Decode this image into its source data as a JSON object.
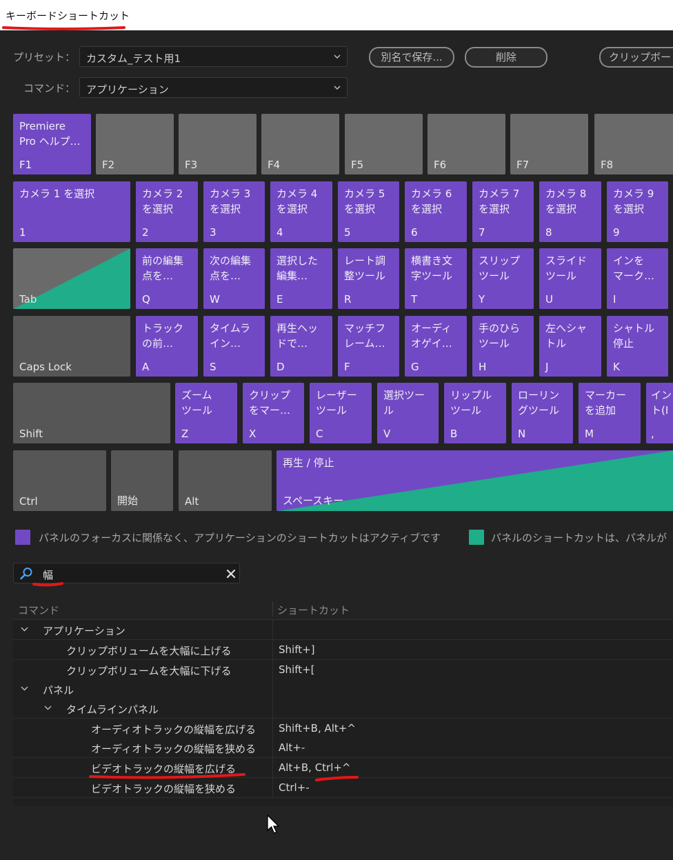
{
  "window": {
    "title": "キーボードショートカット"
  },
  "form": {
    "preset_label": "プリセット：",
    "preset_value": "カスタム_テスト用1",
    "command_label": "コマンド：",
    "command_value": "アプリケーション",
    "buttons": {
      "save_as": "別名で保存...",
      "delete": "削除",
      "clipboard": "クリップボー"
    }
  },
  "keyboard": {
    "fn_row": [
      {
        "cap": "F1",
        "cmd": "Premiere\nPro ヘルプ…"
      },
      {
        "cap": "F2",
        "cmd": ""
      },
      {
        "cap": "F3",
        "cmd": ""
      },
      {
        "cap": "F4",
        "cmd": ""
      },
      {
        "cap": "F5",
        "cmd": ""
      },
      {
        "cap": "F6",
        "cmd": ""
      },
      {
        "cap": "F7",
        "cmd": ""
      },
      {
        "cap": "F8",
        "cmd": ""
      }
    ],
    "num_row": [
      {
        "cap": "1",
        "cmd": "カメラ 1 を選択"
      },
      {
        "cap": "2",
        "cmd": "カメラ 2\nを選択"
      },
      {
        "cap": "3",
        "cmd": "カメラ 3\nを選択"
      },
      {
        "cap": "4",
        "cmd": "カメラ 4\nを選択"
      },
      {
        "cap": "5",
        "cmd": "カメラ 5\nを選択"
      },
      {
        "cap": "6",
        "cmd": "カメラ 6\nを選択"
      },
      {
        "cap": "7",
        "cmd": "カメラ 7\nを選択"
      },
      {
        "cap": "8",
        "cmd": "カメラ 8\nを選択"
      },
      {
        "cap": "9",
        "cmd": "カメラ 9\nを選択"
      }
    ],
    "q_row": [
      {
        "cap": "Tab",
        "cmd": ""
      },
      {
        "cap": "Q",
        "cmd": "前の編集\n点を…"
      },
      {
        "cap": "W",
        "cmd": "次の編集\n点を…"
      },
      {
        "cap": "E",
        "cmd": "選択した\n編集…"
      },
      {
        "cap": "R",
        "cmd": "レート調\n整ツール"
      },
      {
        "cap": "T",
        "cmd": "横書き文\n字ツール"
      },
      {
        "cap": "Y",
        "cmd": "スリップ\nツール"
      },
      {
        "cap": "U",
        "cmd": "スライド\nツール"
      },
      {
        "cap": "I",
        "cmd": "インを\nマーク…"
      }
    ],
    "a_row": [
      {
        "cap": "Caps Lock",
        "cmd": ""
      },
      {
        "cap": "A",
        "cmd": "トラック\nの前…"
      },
      {
        "cap": "S",
        "cmd": "タイムラ\nイン…"
      },
      {
        "cap": "D",
        "cmd": "再生ヘッ\nドで…"
      },
      {
        "cap": "F",
        "cmd": "マッチフ\nレーム…"
      },
      {
        "cap": "G",
        "cmd": "オーディ\nオゲイ…"
      },
      {
        "cap": "H",
        "cmd": "手のひら\nツール"
      },
      {
        "cap": "J",
        "cmd": "左へシャ\nトル"
      },
      {
        "cap": "K",
        "cmd": "シャトル\n停止"
      }
    ],
    "z_row": [
      {
        "cap": "Shift",
        "cmd": ""
      },
      {
        "cap": "Z",
        "cmd": "ズーム\nツール"
      },
      {
        "cap": "X",
        "cmd": "クリップ\nをマー…"
      },
      {
        "cap": "C",
        "cmd": "レーザー\nツール"
      },
      {
        "cap": "V",
        "cmd": "選択ツー\nル"
      },
      {
        "cap": "B",
        "cmd": "リップル\nツール"
      },
      {
        "cap": "N",
        "cmd": "ローリン\nグツール"
      },
      {
        "cap": "M",
        "cmd": "マーカー\nを追加"
      },
      {
        "cap": ",",
        "cmd": "イン\nト(I"
      }
    ],
    "bottom_row": [
      {
        "cap": "Ctrl",
        "cmd": ""
      },
      {
        "cap": "開始",
        "cmd": ""
      },
      {
        "cap": "Alt",
        "cmd": ""
      },
      {
        "cap": "スペースキー",
        "cmd": "再生 / 停止"
      }
    ]
  },
  "legend": {
    "app_text": "パネルのフォーカスに関係なく、アプリケーションのショートカットはアクティブです",
    "panel_text": "パネルのショートカットは、パネルが",
    "app_color": "#7249c4",
    "panel_color": "#1fad8a"
  },
  "search": {
    "value": "幅",
    "icon": "search-icon",
    "clear_icon": "close-icon"
  },
  "table": {
    "columns": [
      "コマンド",
      "ショートカット"
    ],
    "rows": [
      {
        "level": 0,
        "group": true,
        "command": "アプリケーション",
        "shortcut": ""
      },
      {
        "level": 2,
        "group": false,
        "command": "クリップボリュームを大幅に上げる",
        "shortcut": "Shift+]"
      },
      {
        "level": 2,
        "group": false,
        "command": "クリップボリュームを大幅に下げる",
        "shortcut": "Shift+["
      },
      {
        "level": 0,
        "group": true,
        "command": "パネル",
        "shortcut": ""
      },
      {
        "level": 1,
        "group": true,
        "command": "タイムラインパネル",
        "shortcut": ""
      },
      {
        "level": 3,
        "group": false,
        "command": "オーディオトラックの縦幅を広げる",
        "shortcut": "Shift+B, Alt+^"
      },
      {
        "level": 3,
        "group": false,
        "command": "オーディオトラックの縦幅を狭める",
        "shortcut": "Alt+-"
      },
      {
        "level": 3,
        "group": false,
        "command": "ビデオトラックの縦幅を広げる",
        "shortcut": "Alt+B, Ctrl+^"
      },
      {
        "level": 3,
        "group": false,
        "command": "ビデオトラックの縦幅を狭める",
        "shortcut": "Ctrl+-"
      }
    ]
  }
}
